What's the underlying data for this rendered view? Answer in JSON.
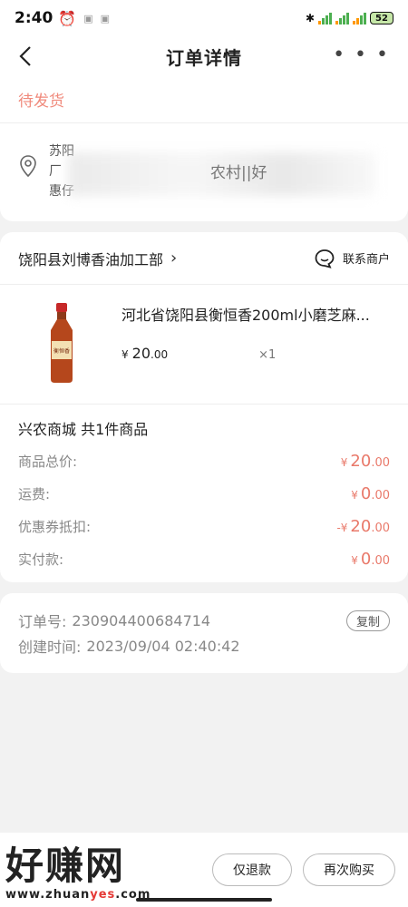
{
  "status_bar": {
    "time": "2:40",
    "battery": "52",
    "hd_label": "HD"
  },
  "nav": {
    "title": "订单详情",
    "more": "• • •"
  },
  "order_status": "待发货",
  "address": {
    "line1": "苏阳",
    "line2": "厂",
    "line3": "惠仔",
    "partial_visible": "农村||好"
  },
  "shop": {
    "name": "饶阳县刘博香油加工部",
    "contact_label": "联系商户"
  },
  "product": {
    "title": "河北省饶阳县衡恒香200ml小磨芝麻...",
    "currency": "¥",
    "price_int": "20",
    "price_dec": ".00",
    "quantity": "×1",
    "image_label": "衡恒香"
  },
  "summary": {
    "title": "兴农商城 共1件商品",
    "rows": [
      {
        "label": "商品总价:",
        "prefix": "¥",
        "int": "20",
        "dec": ".00"
      },
      {
        "label": "运费:",
        "prefix": "¥",
        "int": "0",
        "dec": ".00"
      },
      {
        "label": "优惠券抵扣:",
        "prefix": "-¥",
        "int": "20",
        "dec": ".00"
      },
      {
        "label": "实付款:",
        "prefix": "¥",
        "int": "0",
        "dec": ".00"
      }
    ]
  },
  "order_info": {
    "order_no_label": "订单号:",
    "order_no": "230904400684714",
    "copy_label": "复制",
    "created_label": "创建时间:",
    "created": "2023/09/04 02:40:42"
  },
  "actions": {
    "refund": "仅退款",
    "rebuy": "再次购买"
  },
  "watermark": {
    "text": "好赚网",
    "url_prefix": "www.zhuan",
    "url_highlight": "yes",
    "url_suffix": ".com"
  },
  "colors": {
    "accent": "#e9796a",
    "status": "#f08a7c"
  }
}
